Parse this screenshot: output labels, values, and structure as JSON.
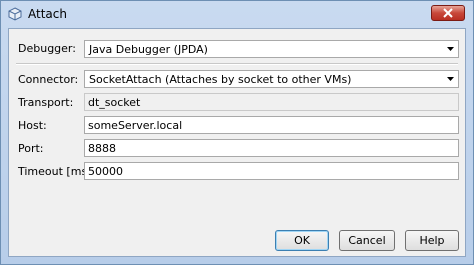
{
  "window": {
    "title": "Attach"
  },
  "debugger": {
    "label": "Debugger:",
    "value": "Java Debugger (JPDA)"
  },
  "connector": {
    "label": "Connector:",
    "value": "SocketAttach (Attaches by socket to other VMs)"
  },
  "transport": {
    "label": "Transport:",
    "value": "dt_socket"
  },
  "host": {
    "label": "Host:",
    "value": "someServer.local"
  },
  "port": {
    "label": "Port:",
    "value": "8888"
  },
  "timeout": {
    "label": "Timeout [ms]:",
    "value": "50000"
  },
  "buttons": {
    "ok": "OK",
    "cancel": "Cancel",
    "help": "Help"
  }
}
